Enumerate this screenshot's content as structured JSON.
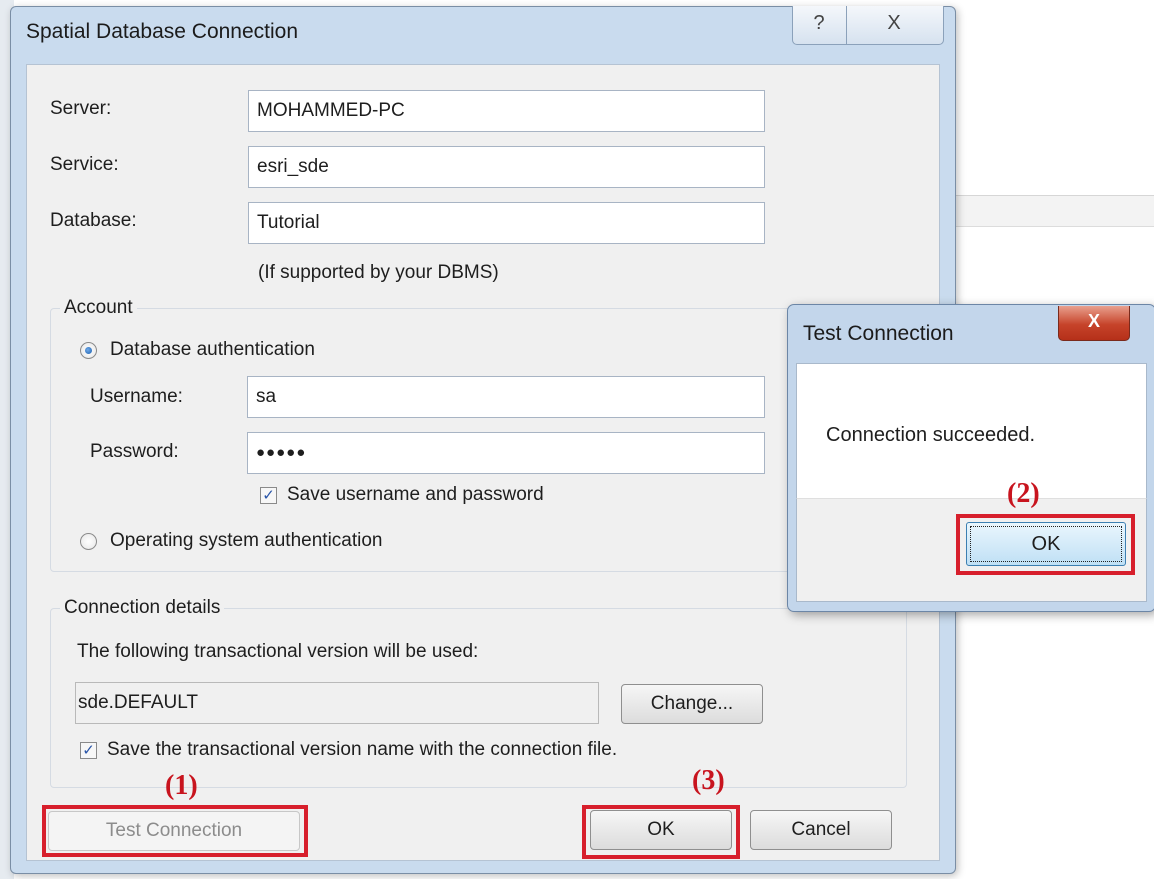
{
  "main_dialog": {
    "title": "Spatial Database Connection",
    "help_glyph": "?",
    "close_glyph": "X",
    "server": {
      "label": "Server:",
      "value": "MOHAMMED-PC"
    },
    "service": {
      "label": "Service:",
      "value": "esri_sde"
    },
    "database": {
      "label": "Database:",
      "value": "Tutorial",
      "hint": "(If supported by your DBMS)"
    },
    "account": {
      "caption": "Account",
      "db_auth": {
        "label": "Database authentication",
        "selected": true
      },
      "username": {
        "label": "Username:",
        "value": "sa"
      },
      "password": {
        "label": "Password:",
        "value": "●●●●●"
      },
      "save_credentials": {
        "label": "Save username and password",
        "checked": true
      },
      "os_auth": {
        "label": "Operating system authentication",
        "selected": false
      }
    },
    "connection_details": {
      "caption": "Connection details",
      "description": "The following transactional version will be used:",
      "version": "sde.DEFAULT",
      "change_button": "Change...",
      "save_version": {
        "label": "Save the transactional version name with the connection file.",
        "checked": true
      }
    },
    "buttons": {
      "test_connection": "Test Connection",
      "ok": "OK",
      "cancel": "Cancel"
    }
  },
  "test_connection_popup": {
    "title": "Test Connection",
    "close_glyph": "X",
    "message": "Connection succeeded.",
    "ok": "OK"
  },
  "annotations": {
    "step1": "(1)",
    "step2": "(2)",
    "step3": "(3)",
    "highlight_color": "#d71f2c"
  },
  "icons": {
    "check_glyph": "✓"
  }
}
